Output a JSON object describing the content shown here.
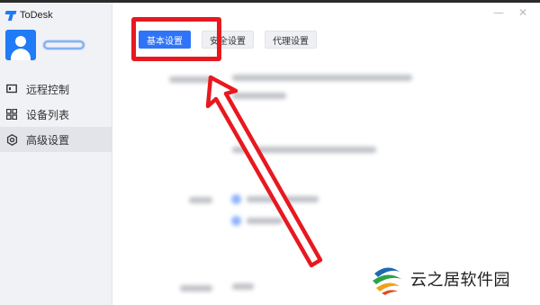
{
  "app": {
    "name": "ToDesk"
  },
  "window_controls": {
    "minimize": "—",
    "close": "✕"
  },
  "sidebar": {
    "items": [
      {
        "label": "远程控制",
        "icon": "monitor-icon"
      },
      {
        "label": "设备列表",
        "icon": "grid-icon"
      },
      {
        "label": "高级设置",
        "icon": "gear-icon",
        "active": true
      }
    ]
  },
  "tabs": [
    {
      "label": "基本设置",
      "active": true
    },
    {
      "label": "安全设置",
      "active": false
    },
    {
      "label": "代理设置",
      "active": false
    }
  ],
  "annotation": {
    "color": "#e7191f"
  },
  "watermark": {
    "text": "云之居软件园"
  },
  "colors": {
    "accent": "#2f74f7",
    "sidebar_bg": "#f1f2f6",
    "highlight": "#e7191f"
  }
}
